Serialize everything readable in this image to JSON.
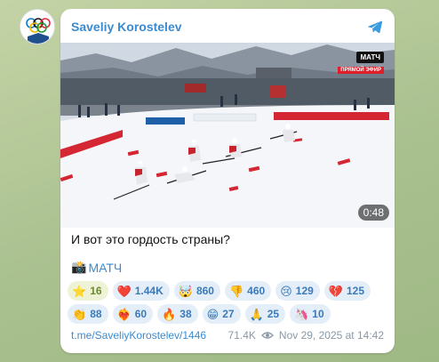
{
  "channel": {
    "name": "Saveliy Korostelev"
  },
  "media": {
    "logo": "МАТЧ",
    "logo_sub": "ПРЯМОЙ ЭФИР",
    "duration": "0:48"
  },
  "post": {
    "caption": "И вот это гордость страны?",
    "source_icon": "camera-emoji",
    "source_label": "МАТЧ",
    "link": "t.me/SaveliyKorostelev/1446",
    "views": "71.4K",
    "date": "Nov 29, 2025 at 14:42"
  },
  "reactions_row1": [
    {
      "emoji": "⭐",
      "count": "16",
      "active": true
    },
    {
      "emoji": "❤️",
      "count": "1.44K"
    },
    {
      "emoji": "🤯",
      "count": "860"
    },
    {
      "emoji": "👎",
      "count": "460"
    },
    {
      "emoji": "😢",
      "count": "129"
    },
    {
      "emoji": "💔",
      "count": "125"
    }
  ],
  "reactions_row2": [
    {
      "emoji": "👏",
      "count": "88"
    },
    {
      "emoji": "❤️‍🔥",
      "count": "60"
    },
    {
      "emoji": "🔥",
      "count": "38"
    },
    {
      "emoji": "😁",
      "count": "27"
    },
    {
      "emoji": "🙏",
      "count": "25"
    },
    {
      "emoji": "🦄",
      "count": "10"
    }
  ],
  "colors": {
    "accent": "#3a8bd0",
    "reaction_bg": "#e4eef8"
  }
}
